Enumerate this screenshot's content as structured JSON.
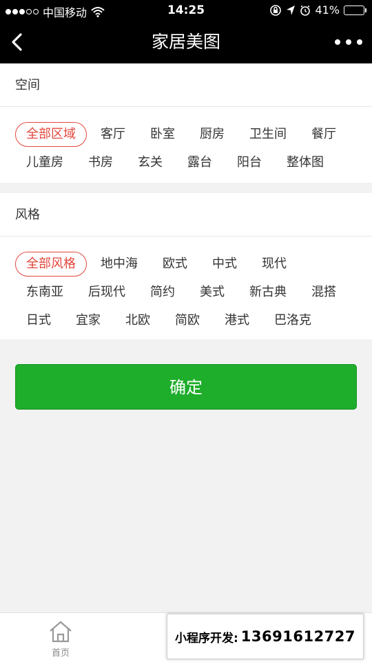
{
  "status_bar": {
    "carrier": "中国移动",
    "time": "14:25",
    "battery_percent": "41%",
    "battery_level": 0.41,
    "signal_bars_filled": 3,
    "signal_bars_total": 5,
    "icons": [
      "wifi-icon",
      "orientation-lock-icon",
      "location-arrow-icon",
      "alarm-icon",
      "battery-icon"
    ]
  },
  "nav": {
    "title": "家居美图",
    "back_icon": "chevron-left-icon",
    "more_icon": "more-dots-icon"
  },
  "space": {
    "heading": "空间",
    "tags": [
      "全部区域",
      "客厅",
      "卧室",
      "厨房",
      "卫生间",
      "餐厅",
      "儿童房",
      "书房",
      "玄关",
      "露台",
      "阳台",
      "整体图"
    ],
    "selected": "全部区域"
  },
  "style": {
    "heading": "风格",
    "tags": [
      "全部风格",
      "地中海",
      "欧式",
      "中式",
      "现代",
      "东南亚",
      "后现代",
      "简约",
      "美式",
      "新古典",
      "混搭",
      "日式",
      "宜家",
      "北欧",
      "简欧",
      "港式",
      "巴洛克"
    ],
    "selected": "全部风格"
  },
  "confirm_label": "确定",
  "tab_bar": {
    "home_label": "首页",
    "home_icon": "home-icon"
  },
  "watermark": {
    "label": "小程序开发:",
    "phone": "13691612727"
  },
  "colors": {
    "accent_green": "#1fad2c",
    "selected_red": "#e2463c",
    "bar_black": "#000000",
    "background": "#f2f2f2"
  }
}
